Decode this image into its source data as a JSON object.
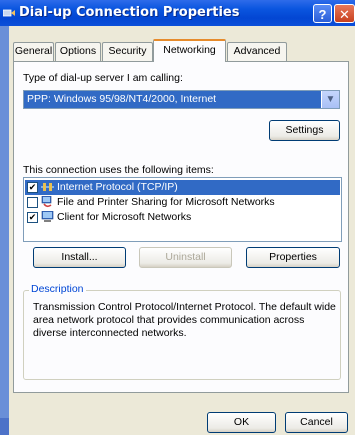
{
  "window": {
    "title": "Dial-up Connection Properties",
    "help_glyph": "?",
    "close_glyph": "✕"
  },
  "tabs": [
    {
      "label": "General"
    },
    {
      "label": "Options"
    },
    {
      "label": "Security"
    },
    {
      "label": "Networking"
    },
    {
      "label": "Advanced"
    }
  ],
  "server_type": {
    "label": "Type of dial-up server I am calling:",
    "selected": "PPP: Windows 95/98/NT4/2000, Internet"
  },
  "settings_button": "Settings",
  "components": {
    "label": "This connection uses the following items:",
    "items": [
      {
        "label": "Internet Protocol (TCP/IP)",
        "checked": "✔",
        "icon": "network-protocol-icon"
      },
      {
        "label": "File and Printer Sharing for Microsoft Networks",
        "checked": "",
        "icon": "file-printer-sharing-icon"
      },
      {
        "label": "Client for Microsoft Networks",
        "checked": "✔",
        "icon": "network-client-icon"
      }
    ]
  },
  "buttons": {
    "install": "Install...",
    "uninstall": "Uninstall",
    "properties": "Properties",
    "ok": "OK",
    "cancel": "Cancel"
  },
  "description": {
    "title": "Description",
    "text": "Transmission Control Protocol/Internet Protocol. The default wide area network protocol that provides communication across diverse interconnected networks."
  },
  "colors": {
    "titlebar": "#0a55df",
    "selection": "#316ac5",
    "active_tab_accent": "#e68b2c",
    "dialog_bg": "#ece9d8"
  }
}
